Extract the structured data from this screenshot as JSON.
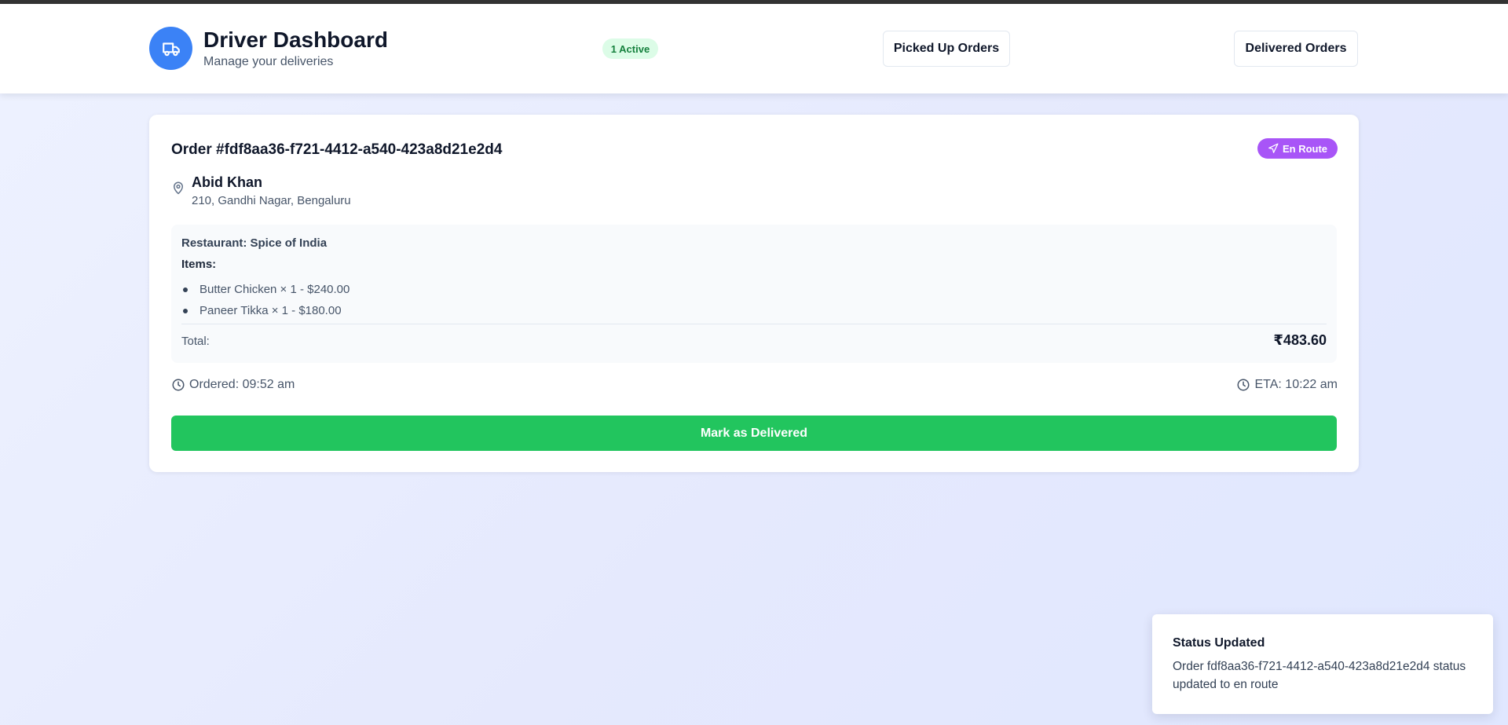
{
  "header": {
    "title": "Driver Dashboard",
    "subtitle": "Manage your deliveries",
    "logo_icon": "truck-icon",
    "active_badge": "1 Active",
    "nav": {
      "picked_up": "Picked Up Orders",
      "delivered": "Delivered Orders"
    }
  },
  "order": {
    "title": "Order #fdf8aa36-f721-4412-a540-423a8d21e2d4",
    "status": "En Route",
    "status_icon": "navigation-arrow-icon",
    "customer_name": "Abid Khan",
    "address": "210, Gandhi Nagar, Bengaluru",
    "restaurant": "Restaurant: Spice of India",
    "items_label": "Items:",
    "items": [
      {
        "text": "Butter Chicken × 1 - $240.00"
      },
      {
        "text": "Paneer Tikka × 1 - $180.00"
      }
    ],
    "total_label": "Total:",
    "total_value": "₹483.60",
    "ordered": "Ordered: 09:52 am",
    "eta": "ETA: 10:22 am",
    "action_label": "Mark as Delivered"
  },
  "toast": {
    "title": "Status Updated",
    "message": "Order fdf8aa36-f721-4412-a540-423a8d21e2d4 status updated to en route"
  },
  "colors": {
    "primary": "#3b82f6",
    "success": "#22c55e",
    "status_en_route": "#a855f7",
    "active_badge_bg": "#dcfce7",
    "active_badge_text": "#15803d"
  }
}
